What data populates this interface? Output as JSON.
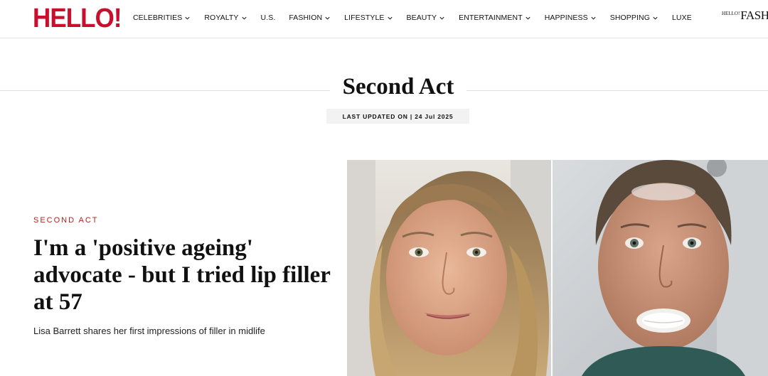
{
  "header": {
    "logo": "HELLO!",
    "nav": [
      {
        "label": "CELEBRITIES",
        "has_dropdown": true
      },
      {
        "label": "ROYALTY",
        "has_dropdown": true
      },
      {
        "label": "U.S.",
        "has_dropdown": false
      },
      {
        "label": "FASHION",
        "has_dropdown": true
      },
      {
        "label": "LIFESTYLE",
        "has_dropdown": true
      },
      {
        "label": "BEAUTY",
        "has_dropdown": true
      },
      {
        "label": "ENTERTAINMENT",
        "has_dropdown": true
      },
      {
        "label": "HAPPINESS",
        "has_dropdown": true
      },
      {
        "label": "SHOPPING",
        "has_dropdown": true
      },
      {
        "label": "LUXE",
        "has_dropdown": false
      }
    ],
    "fashion_logo": "FASHION",
    "fashion_logo_prefix": "HELLO!"
  },
  "section": {
    "title": "Second Act",
    "updated": "LAST UPDATED ON | 24 Jul 2025"
  },
  "article": {
    "kicker": "SECOND ACT",
    "headline": "I'm a 'positive ageing' advocate - but I tried lip filler at 57",
    "standfirst": "Lisa Barrett shares her first impressions of filler in midlife"
  },
  "colors": {
    "brand_red": "#c8102e",
    "kicker_red": "#b3231e",
    "badge_bg": "#f2f2f2"
  }
}
